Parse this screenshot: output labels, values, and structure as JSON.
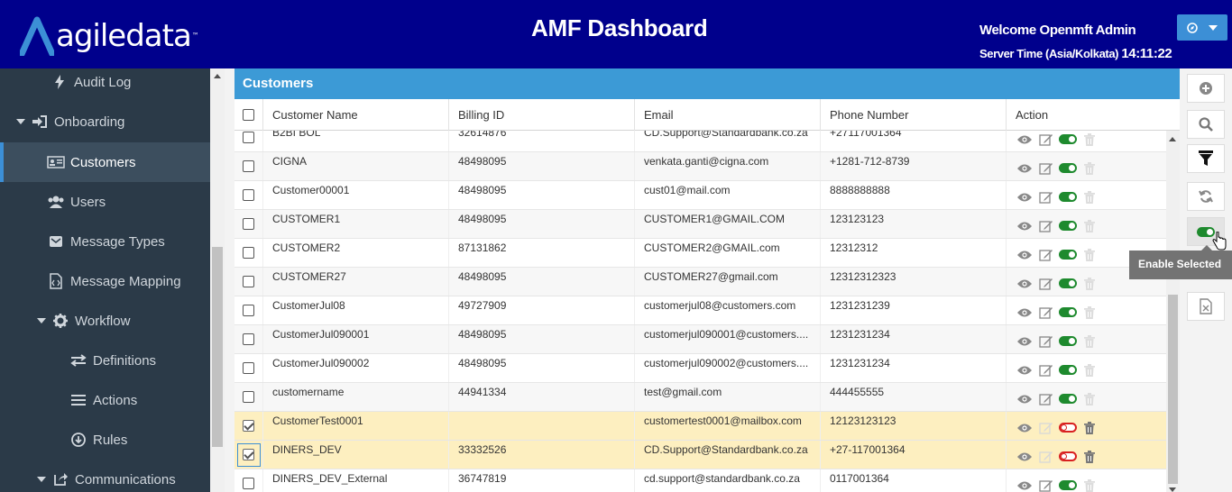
{
  "header": {
    "logo_text": "agiledata",
    "logo_tm": "™",
    "title": "AMF Dashboard",
    "welcome": "Welcome Openmft Admin",
    "server_time_label": "Server Time (Asia/Kolkata)",
    "server_time_value": "14:11:22"
  },
  "sidebar": {
    "items": [
      {
        "label": "Audit Log",
        "icon": "bolt-icon"
      },
      {
        "label": "Onboarding",
        "icon": "sign-in-icon"
      },
      {
        "label": "Customers",
        "icon": "id-card-icon"
      },
      {
        "label": "Users",
        "icon": "users-icon"
      },
      {
        "label": "Message Types",
        "icon": "envelope-icon"
      },
      {
        "label": "Message Mapping",
        "icon": "code-file-icon"
      },
      {
        "label": "Workflow",
        "icon": "gear-icon"
      },
      {
        "label": "Definitions",
        "icon": "exchange-icon"
      },
      {
        "label": "Actions",
        "icon": "list-icon"
      },
      {
        "label": "Rules",
        "icon": "arrow-circle-down-icon"
      },
      {
        "label": "Communications",
        "icon": "share-icon"
      }
    ]
  },
  "panel": {
    "title": "Customers",
    "columns": [
      "Customer Name",
      "Billing ID",
      "Email",
      "Phone Number",
      "Action"
    ]
  },
  "rows": [
    {
      "name": "B2BI BOL",
      "billing": "32614876",
      "email": "CD.Support@Standardbank.co.za",
      "phone": "+27117001364",
      "checked": false,
      "enabled": true
    },
    {
      "name": "CIGNA",
      "billing": "48498095",
      "email": "venkata.ganti@cigna.com",
      "phone": "+1281-712-8739",
      "checked": false,
      "enabled": true
    },
    {
      "name": "Customer00001",
      "billing": "48498095",
      "email": "cust01@mail.com",
      "phone": "8888888888",
      "checked": false,
      "enabled": true
    },
    {
      "name": "CUSTOMER1",
      "billing": "48498095",
      "email": "CUSTOMER1@GMAIL.COM",
      "phone": "123123123",
      "checked": false,
      "enabled": true
    },
    {
      "name": "CUSTOMER2",
      "billing": "87131862",
      "email": "CUSTOMER2@GMAIL.com",
      "phone": "12312312",
      "checked": false,
      "enabled": true
    },
    {
      "name": "CUSTOMER27",
      "billing": "48498095",
      "email": "CUSTOMER27@gmail.com",
      "phone": "12312312323",
      "checked": false,
      "enabled": true
    },
    {
      "name": "CustomerJul08",
      "billing": "49727909",
      "email": "customerjul08@customers.com",
      "phone": "1231231239",
      "checked": false,
      "enabled": true
    },
    {
      "name": "CustomerJul090001",
      "billing": "48498095",
      "email": "customerjul090001@customers....",
      "phone": "1231231234",
      "checked": false,
      "enabled": true
    },
    {
      "name": "CustomerJul090002",
      "billing": "48498095",
      "email": "customerjul090002@customers....",
      "phone": "1231231234",
      "checked": false,
      "enabled": true
    },
    {
      "name": "customername",
      "billing": "44941334",
      "email": "test@gmail.com",
      "phone": "444455555",
      "checked": false,
      "enabled": true
    },
    {
      "name": "CustomerTest0001",
      "billing": "",
      "email": "customertest0001@mailbox.com",
      "phone": "12123123123",
      "checked": true,
      "enabled": false
    },
    {
      "name": "DINERS_DEV",
      "billing": "33332526",
      "email": "CD.Support@Standardbank.co.za",
      "phone": "+27-117001364",
      "checked": true,
      "enabled": false
    },
    {
      "name": "DINERS_DEV_External",
      "billing": "36747819",
      "email": "cd.support@standardbank.co.za",
      "phone": "0117001364",
      "checked": false,
      "enabled": true
    }
  ],
  "toolbar": {
    "buttons": [
      "add-icon",
      "search-icon",
      "filter-icon",
      "refresh-icon",
      "toggle-icon",
      "excel-icon"
    ],
    "tooltip": "Enable Selected"
  },
  "colors": {
    "header_bg": "#00008c",
    "sidebar_bg": "#2b3a48",
    "panel_title_bg": "#3c9ad6",
    "selected_row": "#fdefc0",
    "toggle_on": "#1e8a2e",
    "toggle_off": "#d82020"
  }
}
